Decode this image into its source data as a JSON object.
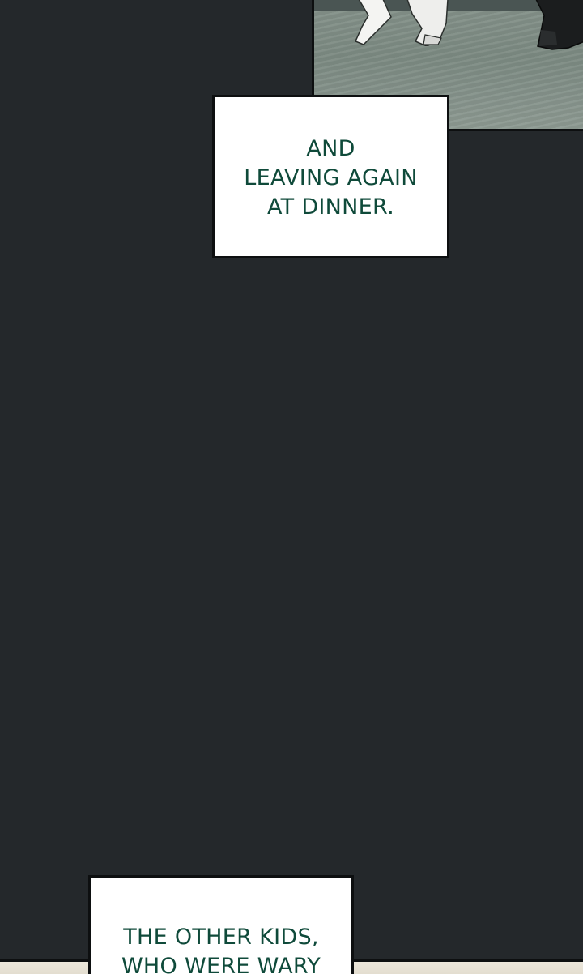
{
  "captions": [
    {
      "lines": [
        "AND",
        "LEAVING AGAIN",
        "AT DINNER."
      ]
    },
    {
      "lines": [
        "THE OTHER KIDS,",
        "WHO WERE WARY"
      ]
    }
  ],
  "colors": {
    "background": "#24282b",
    "caption_text": "#0f4a3a",
    "caption_box": "#ffffff",
    "panel_border": "#0d0f10",
    "floor": "#85928a"
  }
}
